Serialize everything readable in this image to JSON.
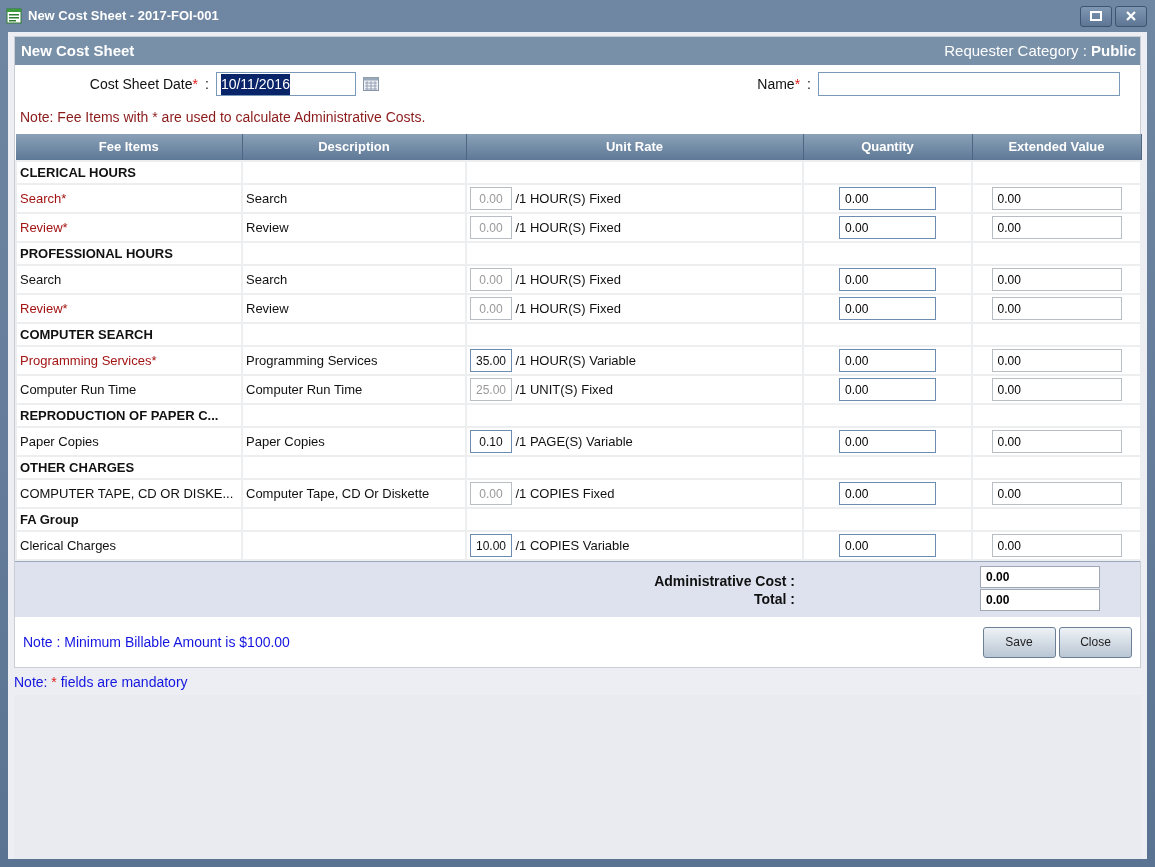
{
  "window": {
    "title": "New Cost Sheet - 2017-FOI-001"
  },
  "panel": {
    "title": "New Cost Sheet",
    "requester_category": "Requester Category : **Public**"
  },
  "form": {
    "date": {
      "label": "Cost Sheet Date",
      "required_mark": "*",
      "colon": ":",
      "value": "10/11/2016",
      "text_selected": true
    },
    "name": {
      "label": "Name",
      "required_mark": "*",
      "colon": ":"
    }
  },
  "note": "Note: Fee Items with * are used to calculate Administrative Costs.",
  "table": {
    "columns": [
      "Fee Items",
      "Description",
      "Unit Rate",
      "Quantity",
      "Extended Value"
    ],
    "rows": [
      {
        "kind": "group",
        "label": "CLERICAL HOURS"
      },
      {
        "kind": "item",
        "fee_item": "Search*",
        "required": true,
        "description": "Search",
        "rate": "0.00",
        "rate_editable": false,
        "unit": "/1 HOUR(S) Fixed",
        "quantity": "0.00",
        "extended_value": "0.00"
      },
      {
        "kind": "item",
        "fee_item": "Review*",
        "required": true,
        "description": "Review",
        "rate": "0.00",
        "rate_editable": false,
        "unit": "/1 HOUR(S) Fixed",
        "quantity": "0.00",
        "extended_value": "0.00"
      },
      {
        "kind": "group",
        "label": "PROFESSIONAL HOURS"
      },
      {
        "kind": "item",
        "fee_item": "Search",
        "required": false,
        "description": "Search",
        "rate": "0.00",
        "rate_editable": false,
        "unit": "/1 HOUR(S) Fixed",
        "quantity": "0.00",
        "extended_value": "0.00"
      },
      {
        "kind": "item",
        "fee_item": "Review*",
        "required": true,
        "description": "Review",
        "rate": "0.00",
        "rate_editable": false,
        "unit": "/1 HOUR(S) Fixed",
        "quantity": "0.00",
        "extended_value": "0.00"
      },
      {
        "kind": "group",
        "label": "COMPUTER SEARCH"
      },
      {
        "kind": "item",
        "fee_item": "Programming Services*",
        "required": true,
        "description": "Programming Services",
        "rate": "35.00",
        "rate_editable": true,
        "unit": "/1 HOUR(S) Variable",
        "quantity": "0.00",
        "extended_value": "0.00"
      },
      {
        "kind": "item",
        "fee_item": "Computer Run Time",
        "required": false,
        "description": "Computer Run Time",
        "rate": "25.00",
        "rate_editable": false,
        "unit": "/1 UNIT(S) Fixed",
        "quantity": "0.00",
        "extended_value": "0.00"
      },
      {
        "kind": "group",
        "label": "REPRODUCTION OF PAPER C..."
      },
      {
        "kind": "item",
        "fee_item": "Paper Copies",
        "required": false,
        "description": "Paper Copies",
        "rate": "0.10",
        "rate_editable": true,
        "unit": "/1 PAGE(S) Variable",
        "quantity": "0.00",
        "extended_value": "0.00"
      },
      {
        "kind": "group",
        "label": "OTHER CHARGES"
      },
      {
        "kind": "item",
        "fee_item": "COMPUTER TAPE, CD OR DISKE...",
        "required": false,
        "description": "Computer Tape, CD Or Diskette",
        "rate": "0.00",
        "rate_editable": false,
        "unit": "/1 COPIES Fixed",
        "quantity": "0.00",
        "extended_value": "0.00"
      },
      {
        "kind": "group",
        "label": "FA Group"
      },
      {
        "kind": "item",
        "fee_item": "Clerical Charges",
        "required": false,
        "description": "",
        "rate": "10.00",
        "rate_editable": true,
        "unit": "/1 COPIES Variable",
        "quantity": "0.00",
        "extended_value": "0.00"
      }
    ]
  },
  "summary": [
    {
      "label": "Administrative Cost :",
      "value": "0.00"
    },
    {
      "label": "Total :",
      "value": "0.00"
    }
  ],
  "footer": {
    "note": "Note : Minimum Billable Amount is $100.00",
    "buttons": [
      "Save",
      "Close"
    ]
  },
  "mandatory_note": {
    "before": "Note:",
    "mark": "*",
    "after": "fields are mandatory"
  }
}
